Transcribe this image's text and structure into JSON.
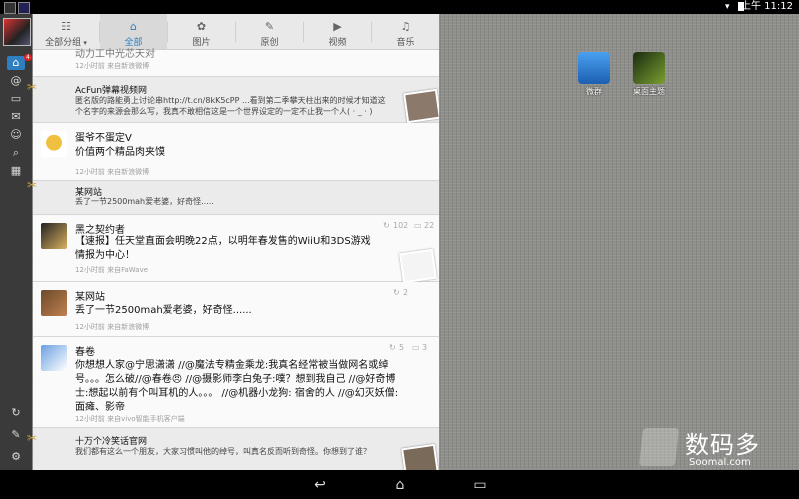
{
  "status_bar": {
    "time": "上午 11:12"
  },
  "tabs": [
    {
      "label": "全部分组",
      "icon": "group-icon",
      "has_dropdown": true
    },
    {
      "label": "全部",
      "icon": "home-icon",
      "active": true
    },
    {
      "label": "图片",
      "icon": "image-icon"
    },
    {
      "label": "原创",
      "icon": "pencil-icon"
    },
    {
      "label": "视频",
      "icon": "video-icon"
    },
    {
      "label": "音乐",
      "icon": "music-icon"
    }
  ],
  "left_sidebar": {
    "badge_count": "4"
  },
  "feed": [
    {
      "partial_text": "动力工中光芯天对",
      "meta": "12小时前 来自新浪微博"
    },
    {
      "user": "AcFun弹幕视频网",
      "text": "匿名版的路能勇上讨论串http://t.cn/8kK5cPP ...看到第二季攀天柱出来的时候才知道这个名字的来源会那么写，我真不敢相信这是一个世界设定的一定不止我一个人( · _ · )",
      "meta": ""
    },
    {
      "user": "蛋爷不蛋定V",
      "text": "价值两个精品肉夹馍",
      "meta": "12小时前 来自新浪微博"
    },
    {
      "user": "某网站",
      "text": "丢了一节2500mah爱老婆，好奇怪.....",
      "meta": ""
    },
    {
      "user": "黑之契约者",
      "text": "【速报】任天堂直面会明晚22点，以明年春发售的WiiU和3DS游戏情报为中心！",
      "meta": "12小时前 来自FaWave",
      "reposts": "102",
      "comments": "22"
    },
    {
      "user": "某网站",
      "text": "丢了一节2500mah爱老婆，好奇怪......",
      "meta": "12小时前 来自新浪微博",
      "reposts": "2"
    },
    {
      "user": "春卷",
      "text": "你想想人家@宁思潇潇 //@魔法专精金乘龙:我真名经常被当做网名或绰号。。。怎么破//@春卷😠 //@摄影师李白兔子:噗？想到我自己 //@好奇博士:想起以前有个叫耳机的人。。。 //@机器小龙狗: 宿舍的人 //@幻灭妖僧: 面瘫、影帝",
      "meta": "12小时前 来自vivo智能手机客户端",
      "reposts": "5",
      "comments": "3"
    },
    {
      "user": "十万个冷笑话官网",
      "text": "我们都有这么一个朋友，大家习惯叫他的绰号，叫真名反而听到奇怪。你想到了谁？",
      "meta": ""
    }
  ],
  "desktop_icons": [
    {
      "label": "微群",
      "icon": "weiqun-app-icon"
    },
    {
      "label": "桌面主题",
      "icon": "theme-app-icon"
    }
  ],
  "watermark": {
    "name": "数码多",
    "url": "Soomal.com"
  },
  "colors": {
    "accent": "#2f7fc0",
    "panel": "#f1f1f1",
    "desk": "#8e8e8a"
  }
}
